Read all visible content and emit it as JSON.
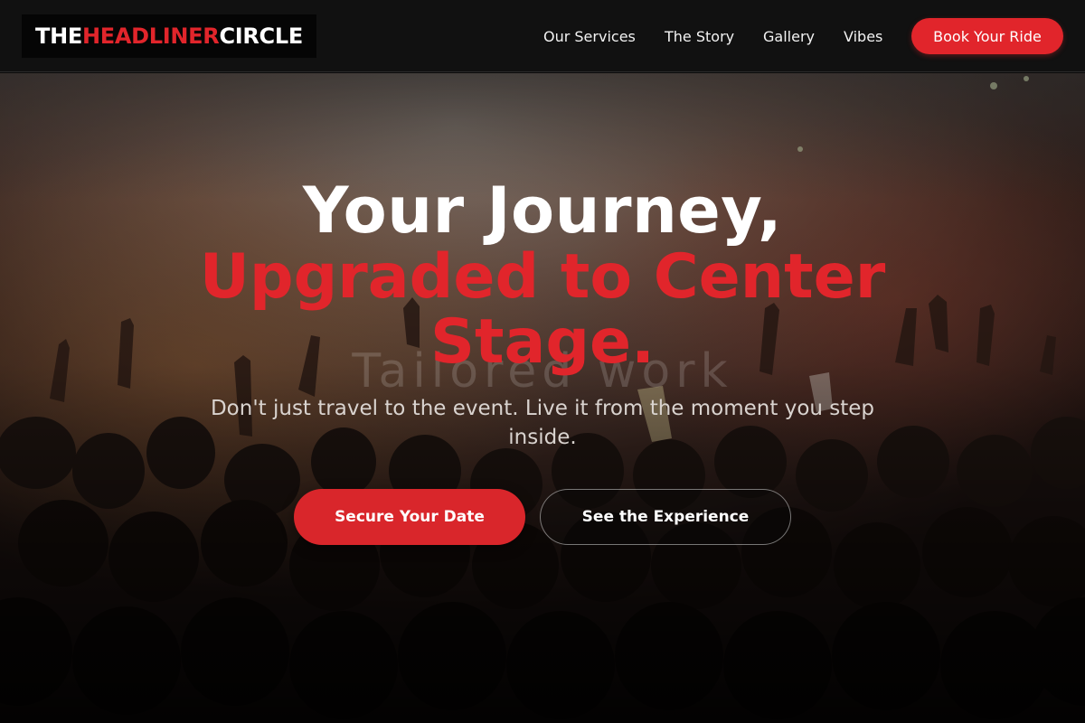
{
  "header": {
    "logo": {
      "part1": "THE ",
      "part2": "HEADLINER",
      "part3": " CIRCLE"
    },
    "nav": [
      {
        "label": "Our Services"
      },
      {
        "label": "The Story"
      },
      {
        "label": "Gallery"
      },
      {
        "label": "Vibes"
      }
    ],
    "cta_label": "Book Your Ride"
  },
  "hero": {
    "title_line1": "Your Journey,",
    "title_line2": "Upgraded to Center",
    "title_line3": "Stage.",
    "watermark": "Tailored work",
    "subtitle": "Don't just travel to the event. Live it from the moment you step inside.",
    "primary_button": "Secure Your Date",
    "secondary_button": "See the Experience",
    "background_image": "concert-crowd-photo"
  },
  "colors": {
    "accent": "#e1252b",
    "header_bg": "#111111",
    "logo_bg": "#050505",
    "text_light": "#ffffff"
  }
}
